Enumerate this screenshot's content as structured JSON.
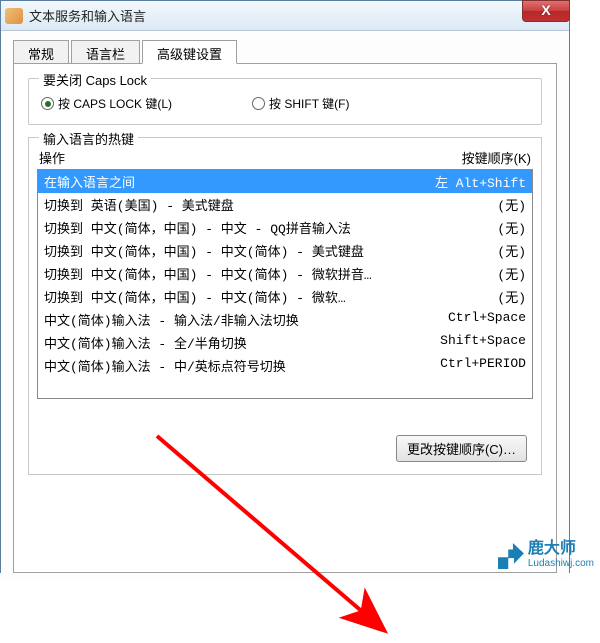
{
  "window": {
    "title": "文本服务和输入语言"
  },
  "tabs": {
    "items": [
      {
        "label": "常规"
      },
      {
        "label": "语言栏"
      },
      {
        "label": "高级键设置"
      }
    ],
    "active_index": 2
  },
  "caps_group": {
    "title": "要关闭 Caps Lock",
    "options": {
      "opt1": "按 CAPS LOCK 键(L)",
      "opt2": "按 SHIFT 键(F)"
    },
    "selected": 0
  },
  "hotkey_group": {
    "title": "输入语言的热键",
    "header_action": "操作",
    "header_sequence": "按键顺序(K)",
    "rows": [
      {
        "action": "在输入语言之间",
        "seq": "左 Alt+Shift",
        "selected": true
      },
      {
        "action": "切换到 英语(美国) - 美式键盘",
        "seq": "(无)"
      },
      {
        "action": "切换到 中文(简体，中国) - 中文 - QQ拼音输入法",
        "seq": "(无)"
      },
      {
        "action": "切换到 中文(简体，中国) - 中文(简体) - 美式键盘",
        "seq": "(无)"
      },
      {
        "action": "切换到 中文(简体，中国) - 中文(简体) - 微软拼音…",
        "seq": "(无)"
      },
      {
        "action": "切换到 中文(简体，中国) - 中文(简体) - 微软…",
        "seq": "(无)"
      },
      {
        "action": "中文(简体)输入法 - 输入法/非输入法切换",
        "seq": "Ctrl+Space"
      },
      {
        "action": "中文(简体)输入法 - 全/半角切换",
        "seq": "Shift+Space"
      },
      {
        "action": "中文(简体)输入法 - 中/英标点符号切换",
        "seq": "Ctrl+PERIOD"
      }
    ],
    "change_button": "更改按键顺序(C)…"
  },
  "watermark": {
    "name": "鹿大师",
    "url": "Ludashiwj.com"
  }
}
